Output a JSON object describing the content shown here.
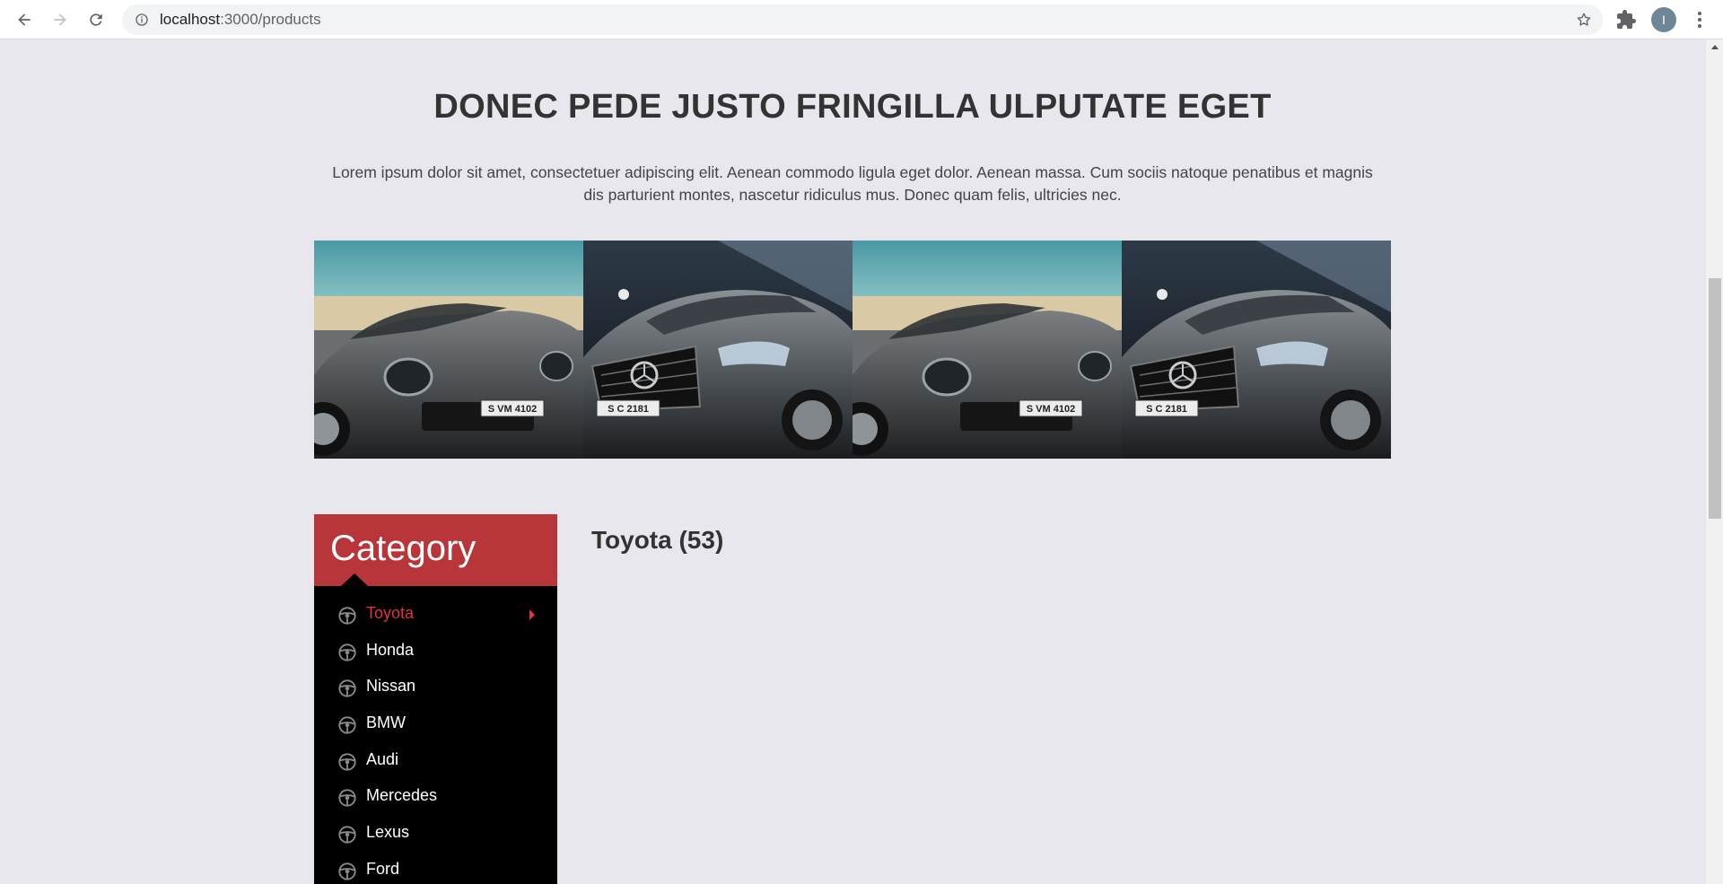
{
  "browser": {
    "url_host": "localhost",
    "url_path": ":3000/products",
    "profile_initial": "I"
  },
  "hero": {
    "title": "DONEC PEDE JUSTO FRINGILLA ULPUTATE EGET",
    "text": "Lorem ipsum dolor sit amet, consectetuer adipiscing elit. Aenean commodo ligula eget dolor. Aenean massa. Cum sociis natoque penatibus et magnis dis parturient montes, nascetur ridiculus mus. Donec quam felis, ultricies nec."
  },
  "gallery": {
    "plates": [
      "S VM 4102",
      "S C 2181",
      "S VM 4102",
      "S C 2181"
    ]
  },
  "category": {
    "title": "Category",
    "items": [
      {
        "label": "Toyota",
        "active": true
      },
      {
        "label": "Honda"
      },
      {
        "label": "Nissan"
      },
      {
        "label": "BMW"
      },
      {
        "label": "Audi"
      },
      {
        "label": "Mercedes"
      },
      {
        "label": "Lexus"
      },
      {
        "label": "Ford"
      }
    ]
  },
  "content": {
    "heading": "Toyota (53)"
  },
  "colors": {
    "accent_red": "#b83539",
    "active_red": "#e0353d",
    "page_bg": "#e9e7ee"
  }
}
